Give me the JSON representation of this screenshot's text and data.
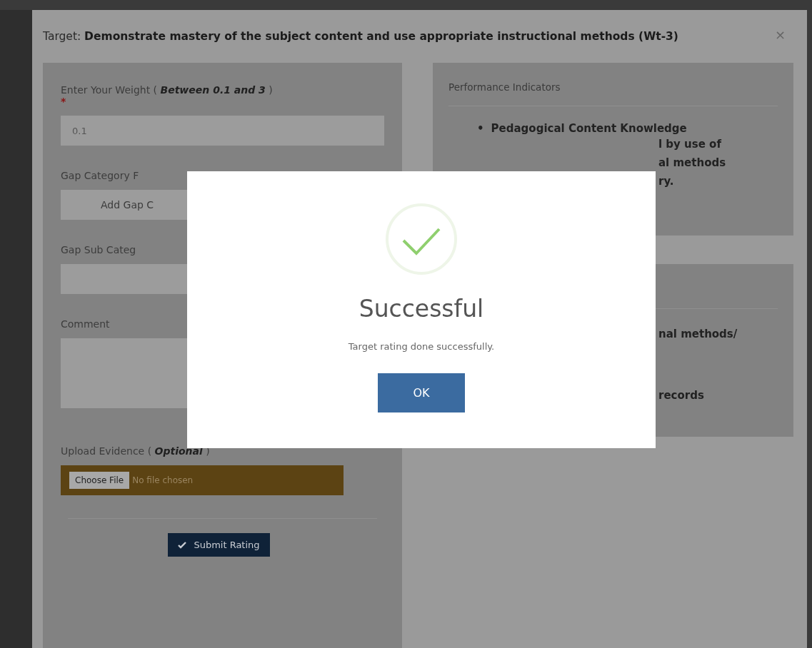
{
  "modal": {
    "title": "Target: **Demonstrate mastery of the subject content and use appropriate instructional methods (Wt-3)**",
    "close": "×"
  },
  "form": {
    "weight_label": "Enter Your Weight ( *Between 0.1 and 3* )",
    "required_mark": "*",
    "weight_value": "0.1",
    "gap_category_label": "Gap Category F",
    "gap_category_value": "Add Gap C",
    "gap_sub_category_label": "Gap Sub Categ",
    "comment_label": "Comment",
    "upload_label": "Upload Evidence ( *Optional* )",
    "file_button": "Choose File",
    "file_status": "No file chosen",
    "submit": "Submit Rating"
  },
  "indicators": {
    "title": "Performance Indicators",
    "bullet": "•",
    "first_line": "Pedagogical Content Knowledge",
    "lines": [
      "l by use of",
      "al methods",
      "ry."
    ]
  },
  "second_card": {
    "lines": [
      "nal methods/",
      "records"
    ]
  },
  "dialog": {
    "title": "Successful",
    "message": "Target rating done successfully.",
    "button": "OK"
  }
}
